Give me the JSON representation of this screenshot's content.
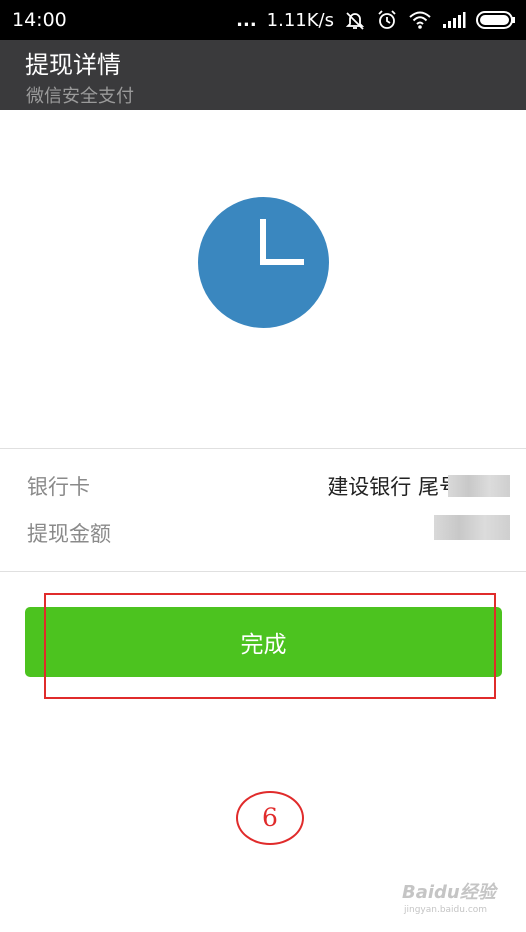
{
  "status_bar": {
    "time": "14:00",
    "dots": "...",
    "network_speed": "1.11K/s",
    "icons": [
      "mute-vibrate-icon",
      "alarm-icon",
      "wifi-icon",
      "signal-icon",
      "battery-icon"
    ]
  },
  "header": {
    "title": "提现详情",
    "subtitle": "微信安全支付"
  },
  "status_icon": {
    "name": "clock-icon",
    "color": "#3a87bf"
  },
  "details": {
    "bank_card_label": "银行卡",
    "bank_card_value": "建设银行 尾号",
    "amount_label": "提现金额"
  },
  "actions": {
    "done_label": "完成",
    "done_color": "#4cc31f"
  },
  "annotation": {
    "step_number": "6",
    "color": "#e02b2b"
  },
  "watermark": {
    "brand": "Baidu经验",
    "url": "jingyan.baidu.com"
  }
}
